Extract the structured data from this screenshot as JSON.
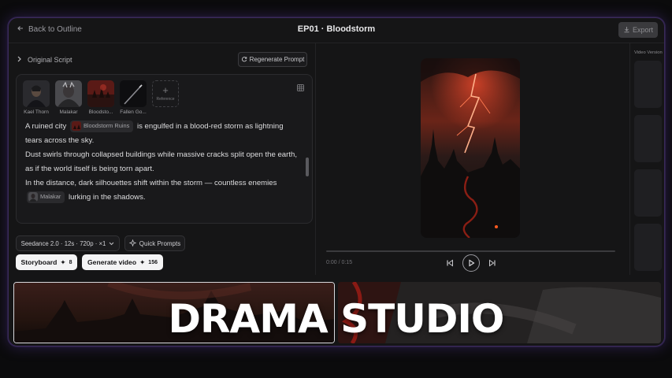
{
  "header": {
    "back_label": "Back to Outline",
    "title": "EP01 · Bloodstorm",
    "export_label": "Export"
  },
  "left": {
    "section_title": "Original Script",
    "regen_label": "Regenerate Prompt",
    "characters": [
      {
        "name": "Kael Thorn"
      },
      {
        "name": "Malakar"
      },
      {
        "name": "Bloodsto..."
      },
      {
        "name": "Fallen Go..."
      }
    ],
    "reference_label": "Reference",
    "script": {
      "l1a": "A ruined city",
      "chip1": "Bloodstorm Ruins",
      "l1b": "is engulfed in a blood-red storm as lightning tears across the sky.",
      "l2": "Dust swirls through collapsed buildings while massive cracks split open the earth, as if the world itself is being torn apart.",
      "l3": "In the distance, dark silhouettes shift within the storm — countless enemies",
      "chip2": "Malakar",
      "l3b": "lurking in the shadows."
    },
    "model_label": "Seedance 2.0 · 12s · 720p · ×1",
    "quick_label": "Quick Prompts",
    "storyboard_label": "Storyboard",
    "storyboard_cost": "8",
    "generate_label": "Generate video",
    "generate_cost": "156"
  },
  "player": {
    "time": "0:00 / 0:15"
  },
  "rail": {
    "title": "Video Version"
  },
  "banner": "DRAMA STUDIO",
  "colors": {
    "accent_glow": "#6e46c8",
    "storm_red": "#e0462a"
  }
}
